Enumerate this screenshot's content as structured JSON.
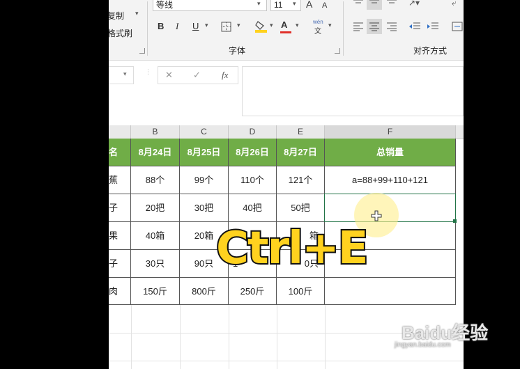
{
  "ribbon": {
    "clipboard": {
      "copy_label": "复制",
      "format_painter_label": "格式刷"
    },
    "font": {
      "font_name": "等线",
      "font_size": "11",
      "group_label": "字体",
      "bold": "B",
      "italic": "I",
      "underline": "U",
      "grow": "A",
      "shrink": "A",
      "phonetic": "wén",
      "phonetic2": "文"
    },
    "alignment": {
      "group_label": "对齐方式"
    }
  },
  "formula_bar": {
    "fx": "fx",
    "cancel": "✕",
    "enter": "✓",
    "content": ""
  },
  "columns": [
    "B",
    "C",
    "D",
    "E",
    "F"
  ],
  "table": {
    "header": [
      "名",
      "8月24日",
      "8月25日",
      "8月26日",
      "8月27日",
      "总销量"
    ],
    "rows": [
      [
        "蕉",
        "88个",
        "99个",
        "110个",
        "121个",
        "a=88+99+110+121"
      ],
      [
        "子",
        "20把",
        "30把",
        "40把",
        "50把",
        ""
      ],
      [
        "果",
        "40箱",
        "20箱",
        "",
        "箱",
        ""
      ],
      [
        "子",
        "30只",
        "90只",
        "1",
        "0只",
        ""
      ],
      [
        "肉",
        "150斤",
        "800斤",
        "250斤",
        "100斤",
        ""
      ]
    ]
  },
  "overlay_text": "Ctrl+E",
  "watermark": {
    "brand": "Baidu经验",
    "url": "jingyan.baidu.com"
  },
  "colors": {
    "header_fill": "#70ad47",
    "overlay": "#ffd21f",
    "highlight": "#fff2a0",
    "font_color_red": "#e0302a"
  }
}
